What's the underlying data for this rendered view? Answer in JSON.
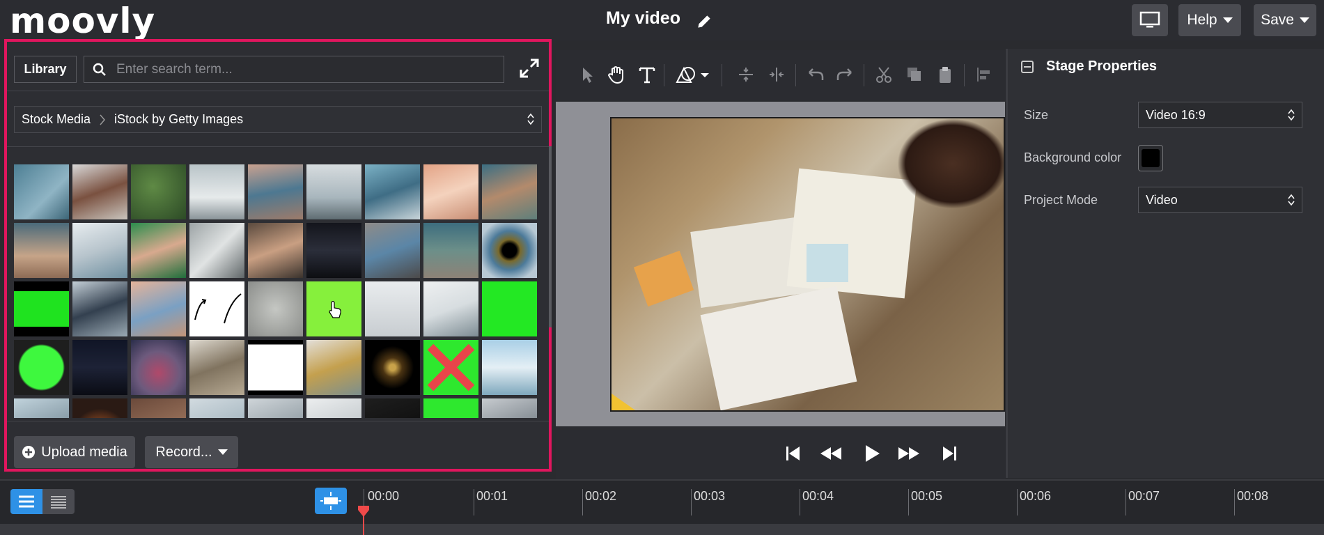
{
  "app": {
    "logo": "moovly",
    "title": "My video"
  },
  "header": {
    "help_label": "Help",
    "save_label": "Save"
  },
  "library": {
    "tab_label": "Library",
    "search_placeholder": "Enter search term...",
    "breadcrumb": [
      "Stock Media",
      "iStock by Getty Images"
    ],
    "upload_label": "Upload media",
    "record_label": "Record..."
  },
  "properties": {
    "title": "Stage Properties",
    "size_label": "Size",
    "size_value": "Video 16:9",
    "bg_label": "Background color",
    "bg_color": "#000000",
    "mode_label": "Project Mode",
    "mode_value": "Video"
  },
  "timeline": {
    "ticks": [
      "00:00",
      "00:01",
      "00:02",
      "00:03",
      "00:04",
      "00:05",
      "00:06",
      "00:07",
      "00:08"
    ]
  },
  "colors": {
    "accent": "#e0165e",
    "active_blue": "#2e91e6",
    "playhead": "#f04a4a"
  }
}
